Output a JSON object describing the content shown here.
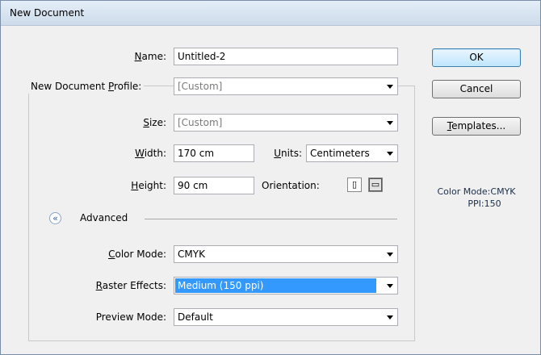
{
  "window": {
    "title": "New Document"
  },
  "form": {
    "name_label": "Name:",
    "name_value": "Untitled-2",
    "profile_group_label": "New Document Profile:",
    "profile_value": "[Custom]",
    "size_label": "Size:",
    "size_value": "[Custom]",
    "width_label": "Width:",
    "width_value": "170 cm",
    "units_label": "Units:",
    "units_value": "Centimeters",
    "height_label": "Height:",
    "height_value": "90 cm",
    "orientation_label": "Orientation:",
    "advanced_label": "Advanced",
    "color_mode_label": "Color Mode:",
    "color_mode_value": "CMYK",
    "raster_label": "Raster Effects:",
    "raster_value": "Medium (150 ppi)",
    "preview_label": "Preview Mode:",
    "preview_value": "Default"
  },
  "buttons": {
    "ok": "OK",
    "cancel": "Cancel",
    "templates": "Templates..."
  },
  "info": {
    "color_mode": "Color Mode:CMYK",
    "ppi": "PPI:150"
  },
  "colors": {
    "selection": "#3399ff",
    "title_bar": "#dbe7f4",
    "dialog_bg": "#f0f0f0"
  },
  "icons": {
    "portrait": "portrait-orientation-icon",
    "landscape": "landscape-orientation-icon",
    "advanced": "chevron-double-up-icon"
  }
}
